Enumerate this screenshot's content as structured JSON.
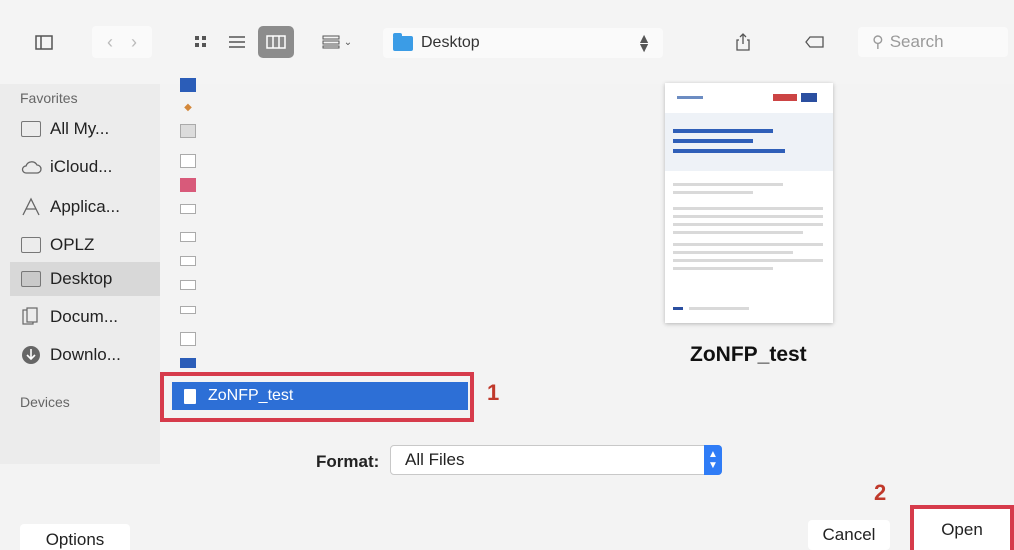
{
  "location": {
    "label": "Desktop"
  },
  "search": {
    "placeholder": "Search"
  },
  "sidebar": {
    "favorites_title": "Favorites",
    "devices_title": "Devices",
    "items": [
      {
        "label": "All My...",
        "icon": "all-my-files-icon"
      },
      {
        "label": "iCloud...",
        "icon": "cloud-icon"
      },
      {
        "label": "Applica...",
        "icon": "applications-icon"
      },
      {
        "label": "OPLZ",
        "icon": "folder-icon"
      },
      {
        "label": "Desktop",
        "icon": "desktop-folder-icon",
        "selected": true
      },
      {
        "label": "Docum...",
        "icon": "documents-icon"
      },
      {
        "label": "Downlo...",
        "icon": "downloads-icon"
      }
    ]
  },
  "file_list": {
    "selected_file": "ZoNFP_test"
  },
  "preview": {
    "filename": "ZoNFP_test"
  },
  "annotations": {
    "marker_1": "1",
    "marker_2": "2",
    "color": "#d63b4b"
  },
  "format": {
    "label": "Format:",
    "value": "All Files"
  },
  "buttons": {
    "options": "Options",
    "cancel": "Cancel",
    "open": "Open"
  },
  "colors": {
    "selection": "#2d6fd6",
    "accent": "#2f7cf6",
    "folder": "#3b9ce6"
  }
}
